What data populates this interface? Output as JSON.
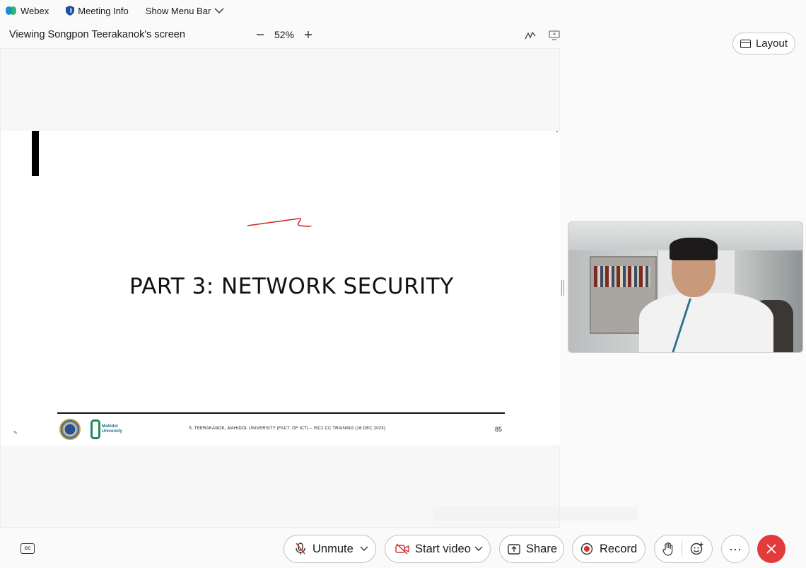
{
  "menubar": {
    "app_name": "Webex",
    "meeting_info": "Meeting Info",
    "show_menu_bar": "Show Menu Bar"
  },
  "view": {
    "title": "Viewing Songpon Teerakanok's screen",
    "zoom_level": "52%"
  },
  "slide": {
    "title": "PART 3: NETWORK SECURITY",
    "footer": "S. TEERAKANOK, MAHIDOL UNIVERSITY (FACT. OF ICT) – ISC2 CC TRAINING (16 DEC 2023)",
    "page_number": "85",
    "logo_text": "Mahidol University"
  },
  "layout_button": {
    "label": "Layout"
  },
  "controls": {
    "unmute": "Unmute",
    "start_video": "Start video",
    "share": "Share",
    "record": "Record",
    "more": "···"
  },
  "colors": {
    "end_call": "#e33a3a",
    "record_dot": "#d32f2f",
    "mute_slash": "#d32f2f",
    "scribble": "#c62828"
  }
}
